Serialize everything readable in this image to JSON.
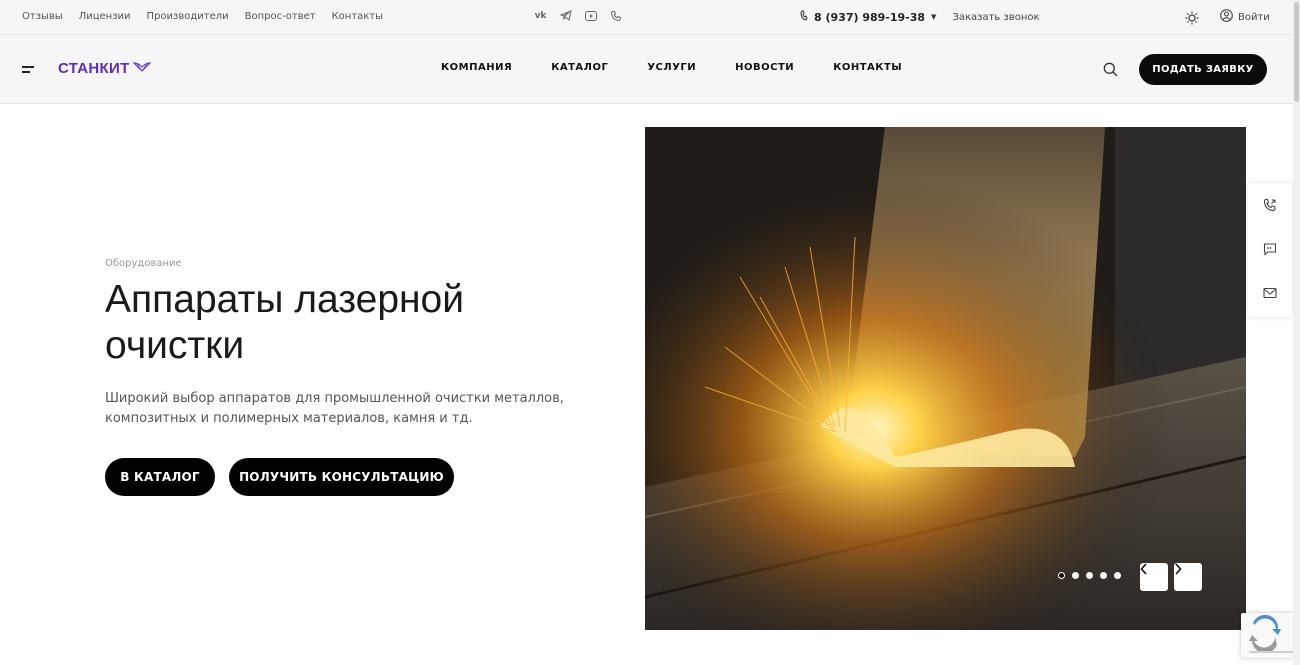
{
  "topbar": {
    "links": [
      "Отзывы",
      "Лицензии",
      "Производители",
      "Вопрос-ответ",
      "Контакты"
    ],
    "social_icons": [
      "vk-icon",
      "telegram-icon",
      "youtube-icon",
      "viber-icon"
    ],
    "phone": "8 (937) 989-19-38",
    "callback_label": "Заказать звонок",
    "login_label": "Войти"
  },
  "header": {
    "logo_text": "СТАНКИТ",
    "nav": [
      "КОМПАНИЯ",
      "КАТАЛОГ",
      "УСЛУГИ",
      "НОВОСТИ",
      "КОНТАКТЫ"
    ],
    "cta_label": "ПОДАТЬ ЗАЯВКУ"
  },
  "hero": {
    "eyebrow": "Оборудование",
    "title": "Аппараты лазерной очистки",
    "description": "Широкий выбор аппаратов для промышленной очистки металлов, композитных и полимерных материалов, камня и тд.",
    "buttons": {
      "catalog": "В КАТАЛОГ",
      "consult": "ПОЛУЧИТЬ КОНСУЛЬТАЦИЮ"
    }
  },
  "slider": {
    "total_slides": 5,
    "active_slide": 1
  },
  "colors": {
    "brand": "#5b2bc4",
    "button": "#000000"
  }
}
